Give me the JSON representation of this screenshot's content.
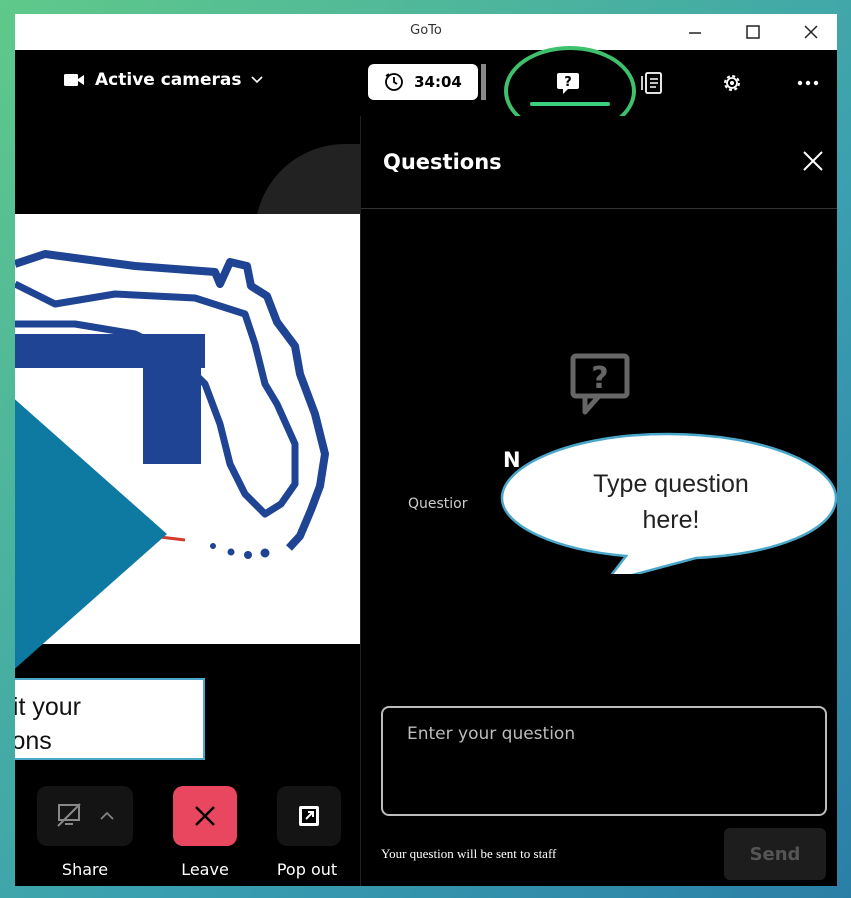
{
  "window": {
    "title": "GoTo"
  },
  "toolbar": {
    "camera_label": "Active cameras",
    "timer": "34:04"
  },
  "panel": {
    "title": "Questions",
    "empty_title": "N",
    "empty_subtitle": "Questior",
    "input_placeholder": "Enter your question",
    "helper_text": "Your question will be sent to staff",
    "send_label": "Send"
  },
  "callouts": {
    "bubble_line1": "Type question",
    "bubble_line2": "here!",
    "box_line1": "nit your",
    "box_line2": "tions"
  },
  "controls": {
    "share_label": "Share",
    "leave_label": "Leave",
    "popout_label": "Pop out"
  },
  "colors": {
    "accent_green": "#3bd080",
    "leave_red": "#e8475f",
    "arrow_blue": "#0e7aa2",
    "logo_blue": "#1f4494"
  },
  "icons": [
    "video-camera-icon",
    "chevron-down-icon",
    "clock-icon",
    "question-chat-icon",
    "notes-icon",
    "gear-icon",
    "more-icon",
    "close-icon",
    "minimize-icon",
    "maximize-icon",
    "share-screen-icon",
    "leave-x-icon",
    "popout-icon"
  ]
}
